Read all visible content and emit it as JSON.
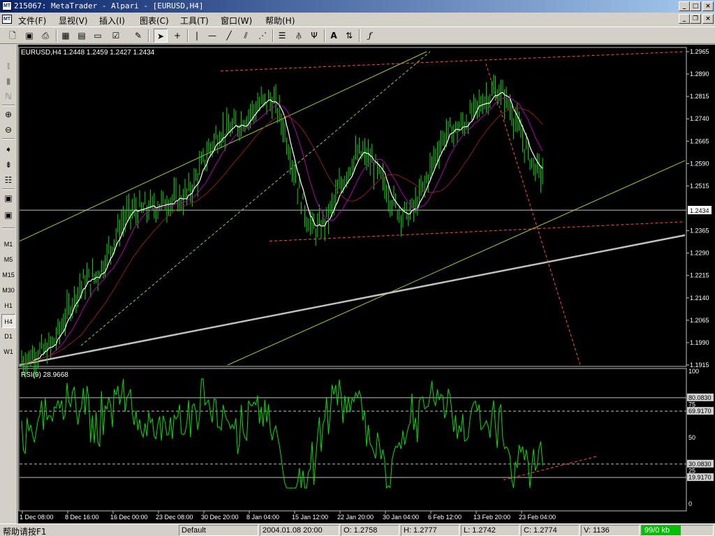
{
  "window": {
    "title": "215067: MetaTrader - Alpari - [EURUSD,H4]",
    "app_icon": "MT"
  },
  "menu": {
    "items": [
      {
        "label": "文件(F)"
      },
      {
        "label": "显视(V)"
      },
      {
        "label": "插入(I)"
      },
      {
        "label": "图表(C)"
      },
      {
        "label": "工具(T)"
      },
      {
        "label": "窗口(W)"
      },
      {
        "label": "帮助(H)"
      }
    ]
  },
  "toolbar": {
    "icons": [
      "new-chart-icon",
      "save-icon",
      "print-icon",
      "market-watch-icon",
      "navigator-icon",
      "terminal-icon",
      "options-icon",
      "expert-icon",
      "cursor-icon",
      "crosshair-icon",
      "vertical-line-icon",
      "horizontal-line-icon",
      "trendline-icon",
      "channel-icon",
      "gann-fan-icon",
      "fibonacci-icon",
      "andrews-pitchfork-icon",
      "text-icon",
      "arrow-label-icon",
      "function-icon"
    ],
    "text_a": "A",
    "text_f": "ƒ"
  },
  "timeframes": [
    "M1",
    "M5",
    "M15",
    "M30",
    "H1",
    "H4",
    "D1",
    "W1"
  ],
  "active_timeframe": "H4",
  "chart": {
    "symbol_info": "EURUSD,H4  1.2448 1.2459 1.2427 1.2434",
    "current_price": "1.2434",
    "price_ticks": [
      "1.2965",
      "1.2890",
      "1.2815",
      "1.2740",
      "1.2665",
      "1.2590",
      "1.2515",
      "1.2365",
      "1.2290",
      "1.2215",
      "1.2140",
      "1.2065",
      "1.1990",
      "1.1915"
    ],
    "rsi_label": "RSI(9)  28.9668",
    "rsi_ticks": [
      "100",
      "75",
      "50",
      "25",
      "0"
    ],
    "rsi_levels": [
      "80.0830",
      "69.9170",
      "30.0830",
      "19.9170"
    ],
    "time_labels": [
      "1 Dec 08:00",
      "8 Dec 16:00",
      "16 Dec 00:00",
      "23 Dec 08:00",
      "30 Dec 20:00",
      "8 Jan 04:00",
      "15 Jan 12:00",
      "22 Jan 20:00",
      "30 Jan 04:00",
      "6 Feb 12:00",
      "13 Feb 20:00",
      "23 Feb 04:00"
    ],
    "colors": {
      "background": "#000000",
      "candle": "#00e000",
      "ma_fast": "#ffffff",
      "ma_mid": "#b000b0",
      "ma_slow": "#8b2020",
      "rsi": "#00e000",
      "trend_green": "#9acd32",
      "trend_red": "#ff5040",
      "trend_gray": "#c0c0c0"
    }
  },
  "chart_data": {
    "type": "candlestick",
    "symbol": "EURUSD",
    "timeframe": "H4",
    "ohlc_last": {
      "open": 1.2448,
      "high": 1.2459,
      "low": 1.2427,
      "close": 1.2434
    },
    "y_range": [
      1.1915,
      1.2965
    ],
    "close_path": [
      {
        "x": "1 Dec 08:00",
        "y": 1.196
      },
      {
        "x": "8 Dec 16:00",
        "y": 1.22
      },
      {
        "x": "16 Dec 00:00",
        "y": 1.243
      },
      {
        "x": "23 Dec 08:00",
        "y": 1.247
      },
      {
        "x": "30 Dec 20:00",
        "y": 1.27
      },
      {
        "x": "8 Jan 04:00",
        "y": 1.28
      },
      {
        "x": "15 Jan 12:00",
        "y": 1.237
      },
      {
        "x": "22 Jan 20:00",
        "y": 1.262
      },
      {
        "x": "30 Jan 04:00",
        "y": 1.242
      },
      {
        "x": "6 Feb 12:00",
        "y": 1.27
      },
      {
        "x": "13 Feb 20:00",
        "y": 1.283
      },
      {
        "x": "23 Feb 04:00",
        "y": 1.256
      }
    ],
    "rsi": {
      "period": 9,
      "last": 28.9668,
      "levels": [
        80.083,
        69.917,
        30.083,
        19.917
      ],
      "y_range": [
        0,
        100
      ]
    }
  },
  "status": {
    "help": "帮助请按F1",
    "profile": "Default",
    "datetime": "2004.01.08 20:00",
    "open": "O: 1.2758",
    "high": "H: 1.2777",
    "low": "L: 1.2742",
    "close": "C: 1.2774",
    "volume": "V: 1136",
    "connection": "99/0 kb",
    "connection_fill": 0.55
  }
}
